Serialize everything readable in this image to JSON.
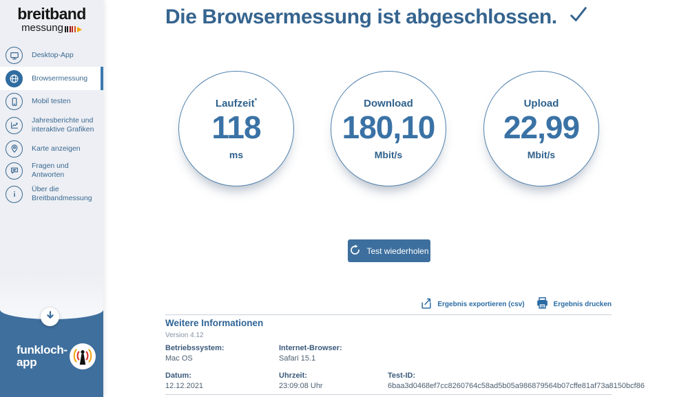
{
  "app": {
    "logo_line1": "breitband",
    "logo_line2": "messung",
    "colors": {
      "title_blue": "#35648e",
      "value_blue": "#3a72a5",
      "button_blue": "#3d6f9e",
      "sidebar_bottom_blue": "#3f6f9d",
      "sidebar_bg": "#edeff4",
      "active_bar_blue": "#3a7ab0",
      "logo_arrow_gold": "#f3a712"
    }
  },
  "sidebar": {
    "items": [
      {
        "label": "Desktop-App",
        "icon": "monitor-icon",
        "active": false
      },
      {
        "label": "Browsermessung",
        "icon": "globe-icon",
        "active": true
      },
      {
        "label": "Mobil testen",
        "icon": "smartphone-icon",
        "active": false
      },
      {
        "label": "Jahresberichte und interaktive Grafiken",
        "icon": "chart-icon",
        "active": false
      },
      {
        "label": "Karte anzeigen",
        "icon": "map-pin-icon",
        "active": false
      },
      {
        "label": "Fragen und Antworten",
        "icon": "chat-icon",
        "active": false
      },
      {
        "label": "Über die Breitbandmessung",
        "icon": "info-icon",
        "active": false
      }
    ],
    "scroll_down_icon": "down-arrow-icon",
    "funkloch": {
      "line1": "funkloch-",
      "line2": "app",
      "icon": "antenna-icon"
    }
  },
  "header": {
    "title": "Die Browsermessung ist abgeschlossen.",
    "icon": "checkmark-icon"
  },
  "results": [
    {
      "label": "Laufzeit",
      "label_suffix": "*",
      "value": "118",
      "unit": "ms"
    },
    {
      "label": "Download",
      "label_suffix": "",
      "value": "180,10",
      "unit": "Mbit/s"
    },
    {
      "label": "Upload",
      "label_suffix": "",
      "value": "22,99",
      "unit": "Mbit/s"
    }
  ],
  "actions": {
    "repeat_button": "Test wiederholen",
    "repeat_icon": "refresh-icon",
    "export_link": "Ergebnis exportieren (csv)",
    "export_icon": "export-icon",
    "print_link": "Ergebnis drucken",
    "print_icon": "printer-icon"
  },
  "info": {
    "heading": "Weitere Informationen",
    "version": "Version 4.12",
    "os_label": "Betriebssystem:",
    "os_value": "Mac OS",
    "browser_label": "Internet-Browser:",
    "browser_value": "Safari 15.1",
    "date_label": "Datum:",
    "date_value": "12.12.2021",
    "time_label": "Uhrzeit:",
    "time_value": "23:09:08 Uhr",
    "testid_label": "Test-ID:",
    "testid_value": "6baa3d0468ef7cc8260764c58ad5b05a986879564b07cffe81af73a8150bcf86"
  }
}
